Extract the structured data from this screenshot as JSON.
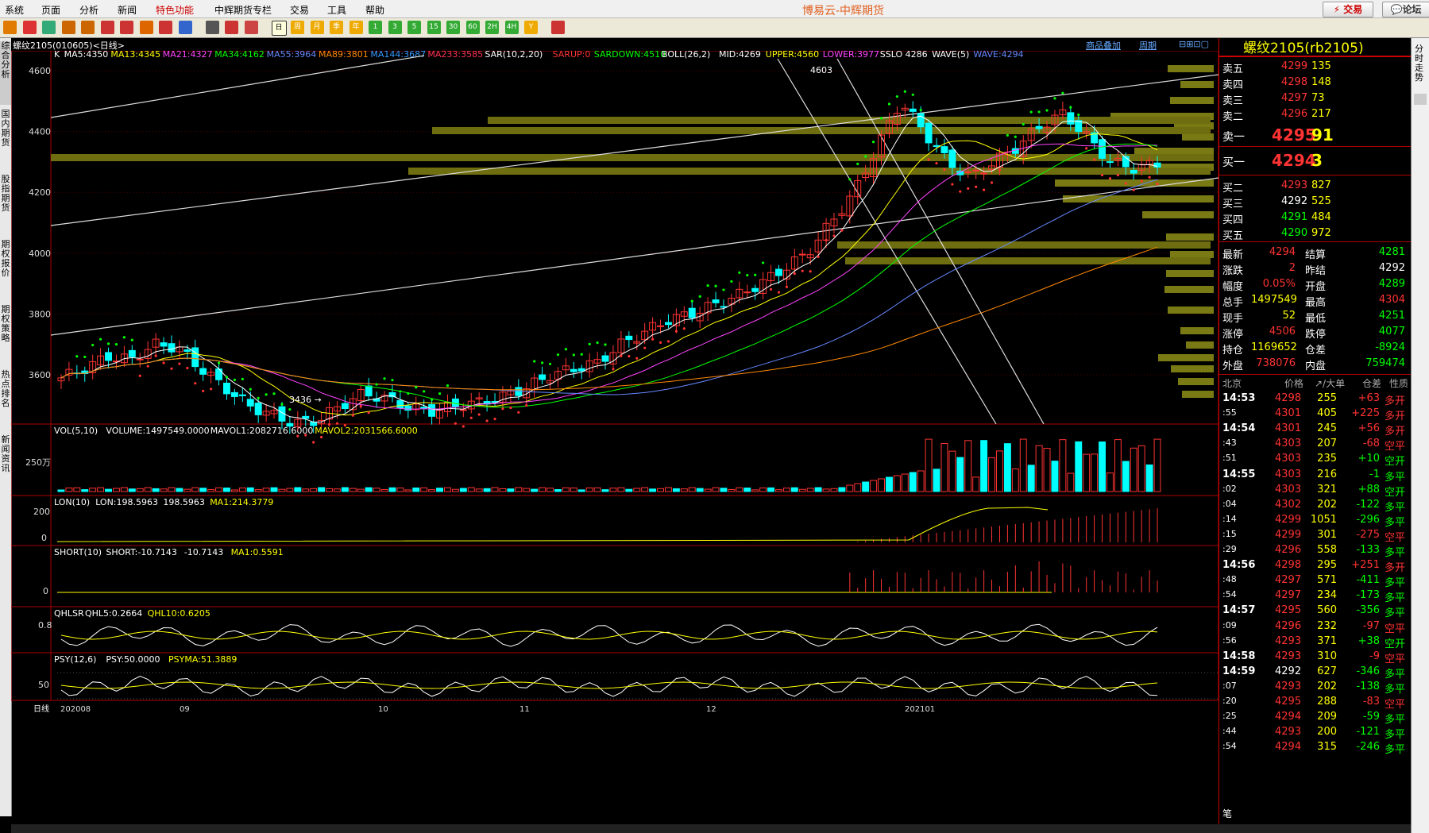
{
  "menu": {
    "items": [
      "系统",
      "页面",
      "分析",
      "新闻",
      "特色功能",
      "中辉期货专栏",
      "交易",
      "工具",
      "帮助"
    ],
    "app_title": "博易云-中辉期货",
    "trade_btn": "交易",
    "forum_btn": "论坛"
  },
  "toolbar": {
    "icons": [
      "back-icon",
      "home-icon",
      "chart-icon",
      "zoom-in-icon",
      "zoom-out-icon",
      "grid-icon",
      "draw-icon",
      "line-icon",
      "pin-icon",
      "news-icon",
      "table-icon",
      "kline-icon",
      "tick-icon",
      "daily-icon",
      "weekly-icon",
      "monthly-icon",
      "quarter-icon",
      "year-icon",
      "min1-icon",
      "min3-icon",
      "min5-icon",
      "min15-icon",
      "min30-icon",
      "min60-icon",
      "hour2-icon",
      "hour4-icon",
      "custom-icon",
      "calc-icon"
    ],
    "labels": [
      "日",
      "周",
      "月",
      "季",
      "年",
      "1",
      "3",
      "5",
      "15",
      "30",
      "60",
      "2H",
      "4H",
      "Y"
    ]
  },
  "left_tabs": [
    "综合分析",
    "国内期货",
    "股指期货",
    "期权报价",
    "期权策略",
    "热点排名",
    "新闻资讯"
  ],
  "chart": {
    "header_title": "螺纹2105(010605)<日线>",
    "overlay_btn": "商品叠加",
    "period_btn": "周期",
    "indicator_line": [
      {
        "t": "K",
        "c": "#ffffff"
      },
      {
        "t": "MA5:4350",
        "c": "#ffffff"
      },
      {
        "t": "MA13:4345",
        "c": "#ffff00"
      },
      {
        "t": "MA21:4327",
        "c": "#ff44ff"
      },
      {
        "t": "MA34:4162",
        "c": "#00ff00"
      },
      {
        "t": "MA55:3964",
        "c": "#6688ff"
      },
      {
        "t": "MA89:3801",
        "c": "#ff8800"
      },
      {
        "t": "MA144:3687",
        "c": "#3399ff"
      },
      {
        "t": "MA233:3585",
        "c": "#ff3355"
      },
      {
        "t": "SAR(10,2,20)",
        "c": "#ffffff"
      },
      {
        "t": "SARUP:0",
        "c": "#ff3333"
      },
      {
        "t": "SARDOWN:4510",
        "c": "#00ff00"
      },
      {
        "t": "BOLL(26,2)",
        "c": "#ffffff"
      },
      {
        "t": "MID:4269",
        "c": "#ffffff"
      },
      {
        "t": "UPPER:4560",
        "c": "#ffff00"
      },
      {
        "t": "LOWER:3977",
        "c": "#ff44ff"
      },
      {
        "t": "SSLO 4286",
        "c": "#ffffff"
      },
      {
        "t": "WAVE(5)",
        "c": "#ffffff"
      },
      {
        "t": "WAVE:4294",
        "c": "#6688ff"
      }
    ],
    "price_axis": [
      "4600",
      "4400",
      "4200",
      "4000",
      "3800",
      "3600"
    ],
    "high_label": "4603",
    "low_label": "3436",
    "vol_line": [
      {
        "t": "VOL(5,10)",
        "c": "#ffffff"
      },
      {
        "t": "VOLUME:1497549.0000",
        "c": "#ffffff"
      },
      {
        "t": "MAVOL1:2082716.6000",
        "c": "#ffffff"
      },
      {
        "t": "MAVOL2:2031566.6000",
        "c": "#ffff00"
      }
    ],
    "vol_axis": "250万",
    "lon_line": [
      {
        "t": "LON(10)",
        "c": "#ffffff"
      },
      {
        "t": "LON:198.5963",
        "c": "#ffffff"
      },
      {
        "t": "198.5963",
        "c": "#ffffff"
      },
      {
        "t": "MA1:214.3779",
        "c": "#ffff00"
      }
    ],
    "lon_axis": [
      "200",
      "0"
    ],
    "short_line": [
      {
        "t": "SHORT(10)",
        "c": "#ffffff"
      },
      {
        "t": "SHORT:-10.7143",
        "c": "#ffffff"
      },
      {
        "t": "-10.7143",
        "c": "#ffffff"
      },
      {
        "t": "MA1:0.5591",
        "c": "#ffff00"
      }
    ],
    "short_axis": "0",
    "qhl_line": [
      {
        "t": "QHLSR",
        "c": "#ffffff"
      },
      {
        "t": "QHL5:0.2664",
        "c": "#ffffff"
      },
      {
        "t": "QHL10:0.6205",
        "c": "#ffff00"
      }
    ],
    "qhl_axis": "0.8",
    "psy_line": [
      {
        "t": "PSY(12,6)",
        "c": "#ffffff"
      },
      {
        "t": "PSY:50.0000",
        "c": "#ffffff"
      },
      {
        "t": "PSYMA:51.3889",
        "c": "#ffff00"
      }
    ],
    "psy_axis": "50",
    "date_axis": [
      "日线",
      "202008",
      "09",
      "10",
      "11",
      "12",
      "202101"
    ]
  },
  "quote": {
    "title": "螺纹2105(rb2105)",
    "asks": [
      {
        "label": "卖五",
        "price": "4299",
        "vol": "135"
      },
      {
        "label": "卖四",
        "price": "4298",
        "vol": "148"
      },
      {
        "label": "卖三",
        "price": "4297",
        "vol": "73"
      },
      {
        "label": "卖二",
        "price": "4296",
        "vol": "217"
      },
      {
        "label": "卖一",
        "price": "4295",
        "vol": "91"
      }
    ],
    "bids": [
      {
        "label": "买一",
        "price": "4294",
        "vol": "3"
      },
      {
        "label": "买二",
        "price": "4293",
        "vol": "827"
      },
      {
        "label": "买三",
        "price": "4292",
        "vol": "525"
      },
      {
        "label": "买四",
        "price": "4291",
        "vol": "484"
      },
      {
        "label": "买五",
        "price": "4290",
        "vol": "972"
      }
    ],
    "stats": [
      {
        "l1": "最新",
        "v1": "4294",
        "c1": "#ff3333",
        "l2": "结算",
        "v2": "4281",
        "c2": "#00ff00"
      },
      {
        "l1": "涨跌",
        "v1": "2",
        "c1": "#ff3333",
        "l2": "昨结",
        "v2": "4292",
        "c2": "#ffffff"
      },
      {
        "l1": "幅度",
        "v1": "0.05%",
        "c1": "#ff3333",
        "l2": "开盘",
        "v2": "4289",
        "c2": "#00ff00"
      },
      {
        "l1": "总手",
        "v1": "1497549",
        "c1": "#ffff00",
        "l2": "最高",
        "v2": "4304",
        "c2": "#ff3333"
      },
      {
        "l1": "现手",
        "v1": "52",
        "c1": "#ffff00",
        "l2": "最低",
        "v2": "4251",
        "c2": "#00ff00"
      },
      {
        "l1": "涨停",
        "v1": "4506",
        "c1": "#ff3333",
        "l2": "跌停",
        "v2": "4077",
        "c2": "#00ff00"
      },
      {
        "l1": "持仓",
        "v1": "1169652",
        "c1": "#ffff00",
        "l2": "仓差",
        "v2": "-8924",
        "c2": "#00ff00"
      },
      {
        "l1": "外盘",
        "v1": "738076",
        "c1": "#ff3333",
        "l2": "内盘",
        "v2": "759474",
        "c2": "#00ff00"
      }
    ],
    "tick_header": [
      "北京",
      "价格",
      "↗/大单",
      "仓差",
      "性质"
    ],
    "ticks": [
      {
        "t": "14:53",
        "p": "4298",
        "v": "255",
        "d": "+63",
        "n": "多开",
        "pc": "#ff3333",
        "dc": "#ff3333",
        "nc": "#ff3333"
      },
      {
        "t": ":55",
        "p": "4301",
        "v": "405",
        "d": "+225",
        "n": "多开",
        "pc": "#ff3333",
        "dc": "#ff3333",
        "nc": "#ff3333"
      },
      {
        "t": "14:54",
        "p": "4301",
        "v": "245",
        "d": "+56",
        "n": "多开",
        "pc": "#ff3333",
        "dc": "#ff3333",
        "nc": "#ff3333"
      },
      {
        "t": ":43",
        "p": "4303",
        "v": "207",
        "d": "-68",
        "n": "空平",
        "pc": "#ff3333",
        "dc": "#ff3333",
        "nc": "#ff3333"
      },
      {
        "t": ":51",
        "p": "4303",
        "v": "235",
        "d": "+10",
        "n": "空开",
        "pc": "#ff3333",
        "dc": "#00ff00",
        "nc": "#00ff00"
      },
      {
        "t": "14:55",
        "p": "4303",
        "v": "216",
        "d": "-1",
        "n": "多平",
        "pc": "#ff3333",
        "dc": "#00ff00",
        "nc": "#00ff00"
      },
      {
        "t": ":02",
        "p": "4303",
        "v": "321",
        "d": "+88",
        "n": "空开",
        "pc": "#ff3333",
        "dc": "#00ff00",
        "nc": "#00ff00"
      },
      {
        "t": ":04",
        "p": "4302",
        "v": "202",
        "d": "-122",
        "n": "多平",
        "pc": "#ff3333",
        "dc": "#00ff00",
        "nc": "#00ff00"
      },
      {
        "t": ":14",
        "p": "4299",
        "v": "1051",
        "d": "-296",
        "n": "多平",
        "pc": "#ff3333",
        "dc": "#00ff00",
        "nc": "#00ff00"
      },
      {
        "t": ":15",
        "p": "4299",
        "v": "301",
        "d": "-275",
        "n": "空平",
        "pc": "#ff3333",
        "dc": "#ff3333",
        "nc": "#ff3333"
      },
      {
        "t": ":29",
        "p": "4296",
        "v": "558",
        "d": "-133",
        "n": "多平",
        "pc": "#ff3333",
        "dc": "#00ff00",
        "nc": "#00ff00"
      },
      {
        "t": "14:56",
        "p": "4298",
        "v": "295",
        "d": "+251",
        "n": "多开",
        "pc": "#ff3333",
        "dc": "#ff3333",
        "nc": "#ff3333"
      },
      {
        "t": ":48",
        "p": "4297",
        "v": "571",
        "d": "-411",
        "n": "多平",
        "pc": "#ff3333",
        "dc": "#00ff00",
        "nc": "#00ff00"
      },
      {
        "t": ":54",
        "p": "4297",
        "v": "234",
        "d": "-173",
        "n": "多平",
        "pc": "#ff3333",
        "dc": "#00ff00",
        "nc": "#00ff00"
      },
      {
        "t": "14:57",
        "p": "4295",
        "v": "560",
        "d": "-356",
        "n": "多平",
        "pc": "#ff3333",
        "dc": "#00ff00",
        "nc": "#00ff00"
      },
      {
        "t": ":09",
        "p": "4296",
        "v": "232",
        "d": "-97",
        "n": "空平",
        "pc": "#ff3333",
        "dc": "#ff3333",
        "nc": "#ff3333"
      },
      {
        "t": ":56",
        "p": "4293",
        "v": "371",
        "d": "+38",
        "n": "空开",
        "pc": "#ff3333",
        "dc": "#00ff00",
        "nc": "#00ff00"
      },
      {
        "t": "14:58",
        "p": "4293",
        "v": "310",
        "d": "-9",
        "n": "空平",
        "pc": "#ff3333",
        "dc": "#ff3333",
        "nc": "#ff3333"
      },
      {
        "t": "14:59",
        "p": "4292",
        "v": "627",
        "d": "-346",
        "n": "多平",
        "pc": "#ffffff",
        "dc": "#00ff00",
        "nc": "#00ff00"
      },
      {
        "t": ":07",
        "p": "4293",
        "v": "202",
        "d": "-138",
        "n": "多平",
        "pc": "#ff3333",
        "dc": "#00ff00",
        "nc": "#00ff00"
      },
      {
        "t": ":20",
        "p": "4295",
        "v": "288",
        "d": "-83",
        "n": "空平",
        "pc": "#ff3333",
        "dc": "#ff3333",
        "nc": "#ff3333"
      },
      {
        "t": ":25",
        "p": "4294",
        "v": "209",
        "d": "-59",
        "n": "多平",
        "pc": "#ff3333",
        "dc": "#00ff00",
        "nc": "#00ff00"
      },
      {
        "t": ":44",
        "p": "4293",
        "v": "200",
        "d": "-121",
        "n": "多平",
        "pc": "#ff3333",
        "dc": "#00ff00",
        "nc": "#00ff00"
      },
      {
        "t": ":54",
        "p": "4294",
        "v": "315",
        "d": "-246",
        "n": "多平",
        "pc": "#ff3333",
        "dc": "#00ff00",
        "nc": "#00ff00"
      }
    ],
    "footer": "笔"
  },
  "right_strip": "分时走势"
}
